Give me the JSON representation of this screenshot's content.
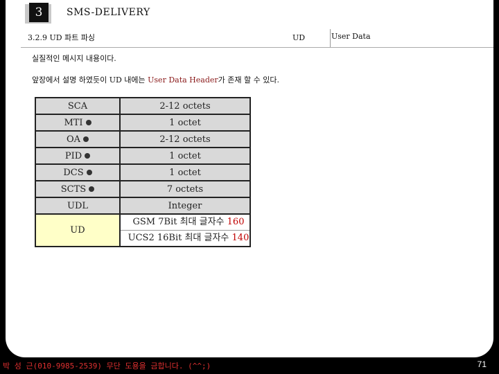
{
  "header": {
    "chapter_number": "3",
    "title": "SMS-DELIVERY",
    "section": "3.2.9 UD 파트 파싱",
    "ud_label": "UD",
    "ud_value": "User Data"
  },
  "body": {
    "line1": "실질적인 메시지 내용이다.",
    "line2_prefix": "앞장에서 설명 하였듯이 UD 내에는 ",
    "line2_highlight": "User Data Header",
    "line2_suffix": "가 존재 할 수 있다."
  },
  "fields": [
    {
      "name": "SCA",
      "value": "2-12 octets",
      "dot": false
    },
    {
      "name": "MTI",
      "value": "1 octet",
      "dot": true
    },
    {
      "name": "OA",
      "value": "2-12 octets",
      "dot": true
    },
    {
      "name": "PID",
      "value": "1 octet",
      "dot": true
    },
    {
      "name": "DCS",
      "value": "1 octet",
      "dot": true
    },
    {
      "name": "SCTS",
      "value": "7 octets",
      "dot": true
    },
    {
      "name": "UDL",
      "value": "Integer",
      "dot": false
    }
  ],
  "ud_row": {
    "name": "UD",
    "gsm_prefix": "GSM 7Bit 최대 글자수 ",
    "gsm_count": "160",
    "ucs_prefix": "UCS2 16Bit 최대 글자수 ",
    "ucs_count": "140"
  },
  "footer": {
    "text": "박 성 근(010-9985-2539) 무단 도용을 금합니다. (^^;)",
    "page": "71"
  },
  "colors": {
    "ud_cell": "#ffffc8",
    "table_cell": "#d9d9d9",
    "highlight": "#c00000",
    "footer_text": "#e03030"
  }
}
